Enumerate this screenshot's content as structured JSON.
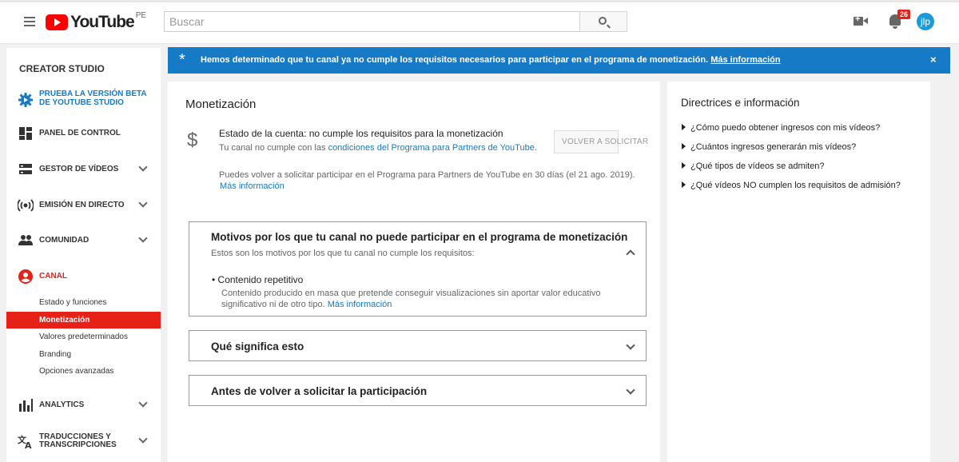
{
  "header": {
    "logo_text": "YouTube",
    "country_code": "PE",
    "search_placeholder": "Buscar",
    "notification_count": "26",
    "avatar_initials": "jlp"
  },
  "sidebar": {
    "title": "CREATOR STUDIO",
    "beta_line1": "PRUEBA LA VERSIÓN BETA",
    "beta_line2": "DE YOUTUBE STUDIO",
    "items": [
      {
        "label": "PANEL DE CONTROL"
      },
      {
        "label": "GESTOR DE VÍDEOS"
      },
      {
        "label": "EMISIÓN EN DIRECTO"
      },
      {
        "label": "COMUNIDAD"
      },
      {
        "label": "CANAL"
      },
      {
        "label": "ANALYTICS"
      }
    ],
    "translations_line1": "TRADUCCIONES Y",
    "translations_line2": "TRANSCRIPCIONES",
    "channel_subitems": [
      {
        "label": "Estado y funciones"
      },
      {
        "label": "Monetización"
      },
      {
        "label": "Valores predeterminados"
      },
      {
        "label": "Branding"
      },
      {
        "label": "Opciones avanzadas"
      }
    ],
    "active_color": "#e62117"
  },
  "banner": {
    "message": "Hemos determinado que tu canal ya no cumple los requisitos necesarios para participar en el programa de monetización.",
    "link": "Más información",
    "close": "×",
    "color": "#167ac6"
  },
  "main": {
    "title": "Monetización",
    "status_title": "Estado de la cuenta: no cumple los requisitos para la monetización",
    "status_sub_prefix": "Tu canal no cumple con las",
    "status_sub_link": "condiciones del Programa para Partners de YouTube.",
    "reapply_button": "VOLVER A SOLICITAR",
    "reapply_text": "Puedes volver a solicitar participar en el Programa para Partners de YouTube en 30 días (el 21 ago. 2019).",
    "reapply_link": "Más información",
    "reasons": {
      "title": "Motivos por los que tu canal no puede participar en el programa de monetización",
      "subtitle": "Estos son los motivos por los que tu canal no cumple los requisitos:",
      "bullet": "Contenido repetitivo",
      "description": "Contenido producido en masa que pretende conseguir visualizaciones sin aportar valor educativo significativo ni de otro tipo.",
      "link": "Más información"
    },
    "meaning_title": "Qué significa esto",
    "before_title": "Antes de volver a solicitar la participación"
  },
  "guidelines": {
    "title": "Directrices e información",
    "questions": [
      "¿Cómo puedo obtener ingresos con mis vídeos?",
      "¿Cuántos ingresos generarán mis vídeos?",
      "¿Qué tipos de vídeos se admiten?",
      "¿Qué vídeos NO cumplen los requisitos de admisión?"
    ]
  }
}
